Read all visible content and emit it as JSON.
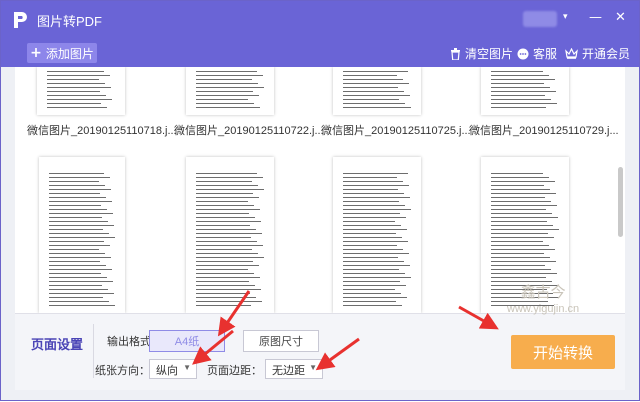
{
  "app": {
    "title": "图片转PDF"
  },
  "window_controls": {
    "minimize": "—",
    "close": "✕",
    "menu_caret": "▾"
  },
  "toolbar": {
    "add_label": "添加图片",
    "clear_label": "清空图片",
    "service_label": "客服",
    "vip_label": "开通会员"
  },
  "images": [
    {
      "filename": "微信图片_20190125110718.j..."
    },
    {
      "filename": "微信图片_20190125110722.j..."
    },
    {
      "filename": "微信图片_20190125110725.j..."
    },
    {
      "filename": "微信图片_20190125110729.j..."
    }
  ],
  "page_settings": {
    "title": "页面设置",
    "output_format_label": "输出格式：",
    "format_options": [
      "A4纸",
      "原图尺寸"
    ],
    "selected_format": "A4纸",
    "orientation_label": "纸张方向：",
    "orientation_value": "纵向",
    "margin_label": "页面边距：",
    "margin_value": "无边距"
  },
  "start_button": {
    "label": "开始转换"
  },
  "watermark": {
    "line1": "鑫古今",
    "line2": "www.yigujin.cn"
  },
  "colors": {
    "title_bar": "#6a64d6",
    "accent": "#8f8be6",
    "start": "#f7ad4d",
    "arrow": "#e8312f"
  }
}
